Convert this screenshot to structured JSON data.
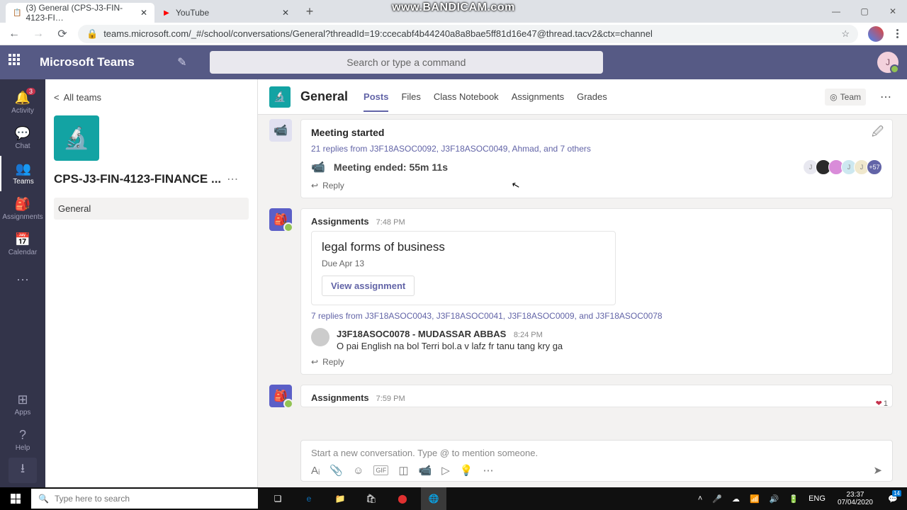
{
  "watermark": "www.BANDICAM.com",
  "browser": {
    "tab1_title": "(3) General (CPS-J3-FIN-4123-FI…",
    "tab2_title": "YouTube",
    "url": "teams.microsoft.com/_#/school/conversations/General?threadId=19:ccecabf4b44240a8a8bae5ff81d16e47@thread.tacv2&ctx=channel"
  },
  "teams": {
    "title": "Microsoft Teams",
    "search_placeholder": "Search or type a command",
    "avatar_initial": "J"
  },
  "rail": {
    "activity": "Activity",
    "activity_badge": "3",
    "chat": "Chat",
    "teams": "Teams",
    "assignments": "Assignments",
    "calendar": "Calendar",
    "apps": "Apps",
    "help": "Help"
  },
  "panel": {
    "all_teams": "All teams",
    "team_name": "CPS-J3-FIN-4123-FINANCE ...",
    "channel": "General"
  },
  "header": {
    "channel": "General",
    "tabs": {
      "posts": "Posts",
      "files": "Files",
      "notebook": "Class Notebook",
      "assignments": "Assignments",
      "grades": "Grades"
    },
    "team_button": "Team"
  },
  "msg1": {
    "started": "Meeting started",
    "replies": "21 replies from J3F18ASOC0092, J3F18ASOC0049, Ahmad, and 7 others",
    "ended": "Meeting ended: 55m 11s",
    "reply": "Reply",
    "overflow": "+57"
  },
  "msg2": {
    "author": "Assignments",
    "time": "7:48 PM",
    "title": "legal forms of business",
    "due": "Due Apr 13",
    "view": "View assignment",
    "replies": "7 replies from J3F18ASOC0043, J3F18ASOC0041, J3F18ASOC0009, and J3F18ASOC0078",
    "reply_author": "J3F18ASOC0078 - MUDASSAR ABBAS",
    "reply_time": "8:24 PM",
    "reply_text": "O pai English na bol Terri bol.a v lafz fr tanu tang kry ga",
    "reply": "Reply"
  },
  "msg3": {
    "author": "Assignments",
    "time": "7:59 PM",
    "reaction_count": "1"
  },
  "compose": {
    "placeholder": "Start a new conversation. Type @ to mention someone."
  },
  "taskbar": {
    "search": "Type here to search",
    "lang": "ENG",
    "time": "23:37",
    "date": "07/04/2020",
    "notif_count": "14"
  }
}
